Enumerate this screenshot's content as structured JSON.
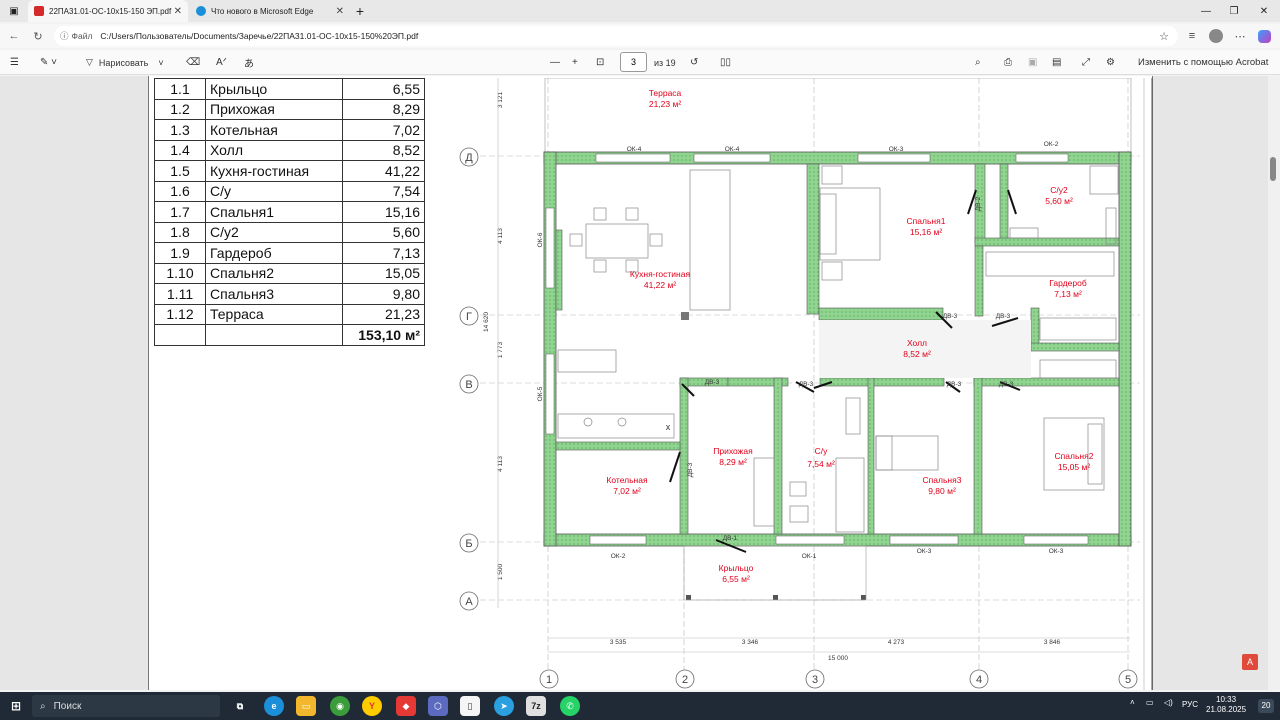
{
  "browser": {
    "tabs": [
      {
        "title": "22ПА31.01-ОС-10х15-150 ЭП.pdf",
        "active": true
      },
      {
        "title": "Что нового в Microsoft Edge",
        "active": false
      }
    ],
    "new_tab_symbol": "+",
    "url_prefix": "Файл",
    "url": "C:/Users/Пользователь/Documents/Заречье/22ПА31.01-ОС-10х15-150%20ЭП.pdf"
  },
  "pdf_toolbar": {
    "draw_label": "Нарисовать",
    "current_page": "3",
    "page_total": "из 19",
    "edit_acrobat": "Изменить с помощью Acrobat"
  },
  "rooms_table": {
    "rows": [
      {
        "num": "1.1",
        "name": "Крыльцо",
        "area": "6,55"
      },
      {
        "num": "1.2",
        "name": "Прихожая",
        "area": "8,29"
      },
      {
        "num": "1.3",
        "name": "Котельная",
        "area": "7,02"
      },
      {
        "num": "1.4",
        "name": "Холл",
        "area": "8,52"
      },
      {
        "num": "1.5",
        "name": "Кухня-гостиная",
        "area": "41,22"
      },
      {
        "num": "1.6",
        "name": "С/у",
        "area": "7,54"
      },
      {
        "num": "1.7",
        "name": "Спальня1",
        "area": "15,16"
      },
      {
        "num": "1.8",
        "name": "С/у2",
        "area": "5,60"
      },
      {
        "num": "1.9",
        "name": "Гардероб",
        "area": "7,13"
      },
      {
        "num": "1.10",
        "name": "Спальня2",
        "area": "15,05"
      },
      {
        "num": "1.11",
        "name": "Спальня3",
        "area": "9,80"
      },
      {
        "num": "1.12",
        "name": "Терраса",
        "area": "21,23"
      }
    ],
    "total": "153,10 м²"
  },
  "plan": {
    "rooms": {
      "terrace": {
        "name": "Терраса",
        "area": "21,23 м²"
      },
      "kitchen": {
        "name": "Кухня-гостиная",
        "area": "41,22 м²"
      },
      "bed1": {
        "name": "Спальня1",
        "area": "15,16 м²"
      },
      "wc2": {
        "name": "С/у2",
        "area": "5,60 м²"
      },
      "wardrobe": {
        "name": "Гардероб",
        "area": "7,13 м²"
      },
      "hall": {
        "name": "Холл",
        "area": "8,52 м²"
      },
      "hallway": {
        "name": "Прихожая",
        "area": "8,29 м²"
      },
      "boiler": {
        "name": "Котельная",
        "area": "7,02 м²"
      },
      "wc": {
        "name": "С/у",
        "area": "7,54 м²"
      },
      "bed3": {
        "name": "Спальня3",
        "area": "9,80 м²"
      },
      "bed2": {
        "name": "Спальня2",
        "area": "15,05 м²"
      },
      "porch": {
        "name": "Крыльцо",
        "area": "6,55 м²"
      }
    },
    "row_axes": [
      "Д",
      "Г",
      "В",
      "Б",
      "А"
    ],
    "col_axes": [
      "1",
      "2",
      "3",
      "4",
      "5"
    ],
    "col_dims": [
      "3 535",
      "3 346",
      "4 273",
      "3 846"
    ],
    "total_width": "15 000",
    "row_dims": [
      "3 121",
      "4 113",
      "1 773",
      "4 113",
      "1 500"
    ],
    "total_height": "14 620",
    "windows": {
      "ok4a": "ОК-4",
      "ok4b": "ОК-4",
      "ok3top": "ОК-3",
      "ok2top": "ОК-2",
      "ok6": "ОК-6",
      "ok5": "ОК-5",
      "ok2bot": "ОК-2",
      "ok1": "ОК-1",
      "ok3bot1": "ОК-3",
      "ok3bot2": "ОК-3"
    },
    "doors": {
      "dv1": "ДВ-1",
      "dv2a": "ДВ-2",
      "dv3a": "ДВ-3",
      "dv3b": "ДВ-3",
      "dv3c": "ДВ-3",
      "dv3d": "ДВ-3",
      "dv3e": "ДВ-3",
      "dv3f": "ДВ-3",
      "dv3g": "ДВ-3"
    },
    "stove_mark": "x"
  },
  "taskbar": {
    "search_placeholder": "Поиск",
    "lang": "РУС",
    "time": "10:33",
    "date": "21.08.2025",
    "notif_count": "20"
  },
  "colors": {
    "wall_fill": "#8fd48f",
    "wall_stroke": "#555555",
    "room_label": "#e0001a",
    "taskbar_bg": "#1f2a36"
  }
}
